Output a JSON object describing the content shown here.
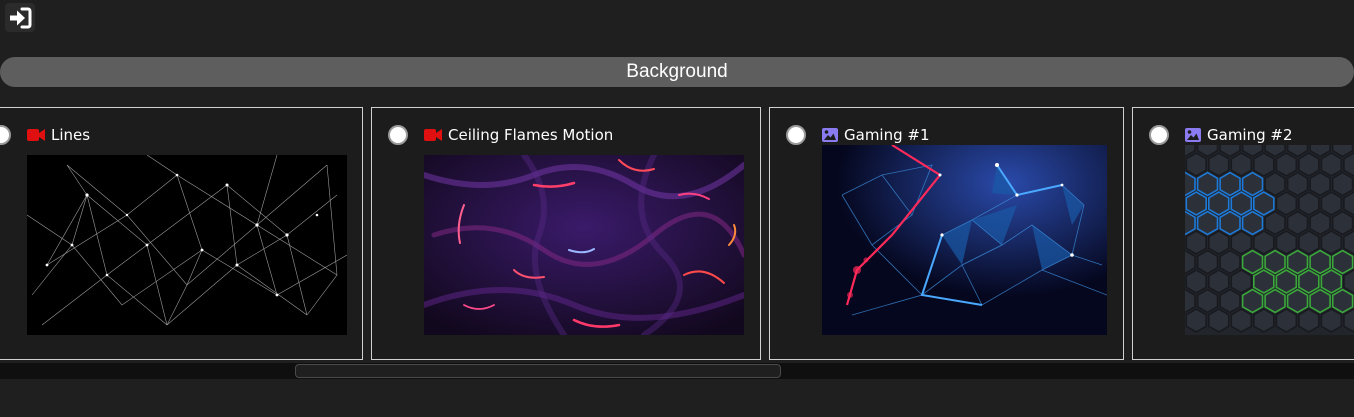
{
  "header": {
    "login_icon": "sign-in-icon"
  },
  "section": {
    "title": "Background"
  },
  "backgrounds": [
    {
      "title": "Lines",
      "type_icon": "video-icon",
      "type_color": "#e01010"
    },
    {
      "title": "Ceiling Flames Motion",
      "type_icon": "video-icon",
      "type_color": "#e01010"
    },
    {
      "title": "Gaming #1",
      "type_icon": "image-icon",
      "type_color": "#8a7cf0"
    },
    {
      "title": "Gaming #2",
      "type_icon": "image-icon",
      "type_color": "#8a7cf0"
    }
  ]
}
